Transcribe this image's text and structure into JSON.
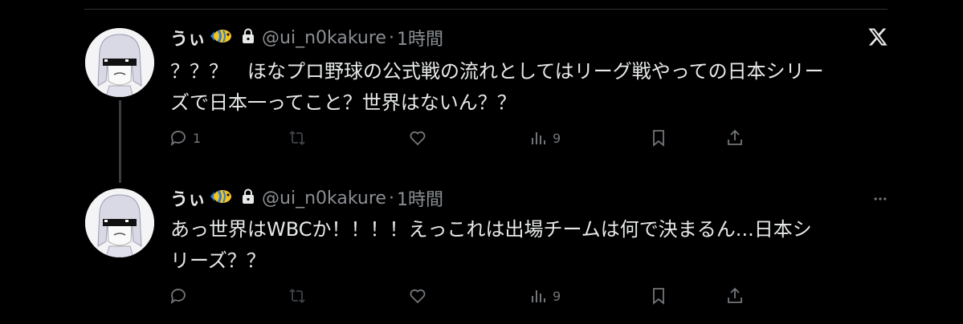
{
  "tweets": [
    {
      "name": "うぃ",
      "handle": "@ui_n0kakure",
      "separator": "·",
      "time": "1時間",
      "text_line1": "？？？　ほなプロ野球の公式戦の流れとしてはリーグ戦やっての日本シリー",
      "text_line2": "ズで日本一ってこと？世界はないん？？",
      "replies": "1",
      "retweets": "",
      "likes": "",
      "views": "9"
    },
    {
      "name": "うぃ",
      "handle": "@ui_n0kakure",
      "separator": "·",
      "time": "1時間",
      "text_line1": "あっ世界はWBCか！！！！えっこれは出場チームは何で決まるん...日本シ",
      "text_line2": "リーズ？？",
      "replies": "",
      "retweets": "",
      "likes": "",
      "views": "9"
    }
  ],
  "icons": {
    "brand": "x-logo-icon",
    "lock": "lock-icon",
    "emoji": "tropical-fish-icon",
    "more": "more-icon"
  },
  "colors": {
    "background": "#000000",
    "text": "#e7e9ea",
    "muted": "#71767b"
  }
}
